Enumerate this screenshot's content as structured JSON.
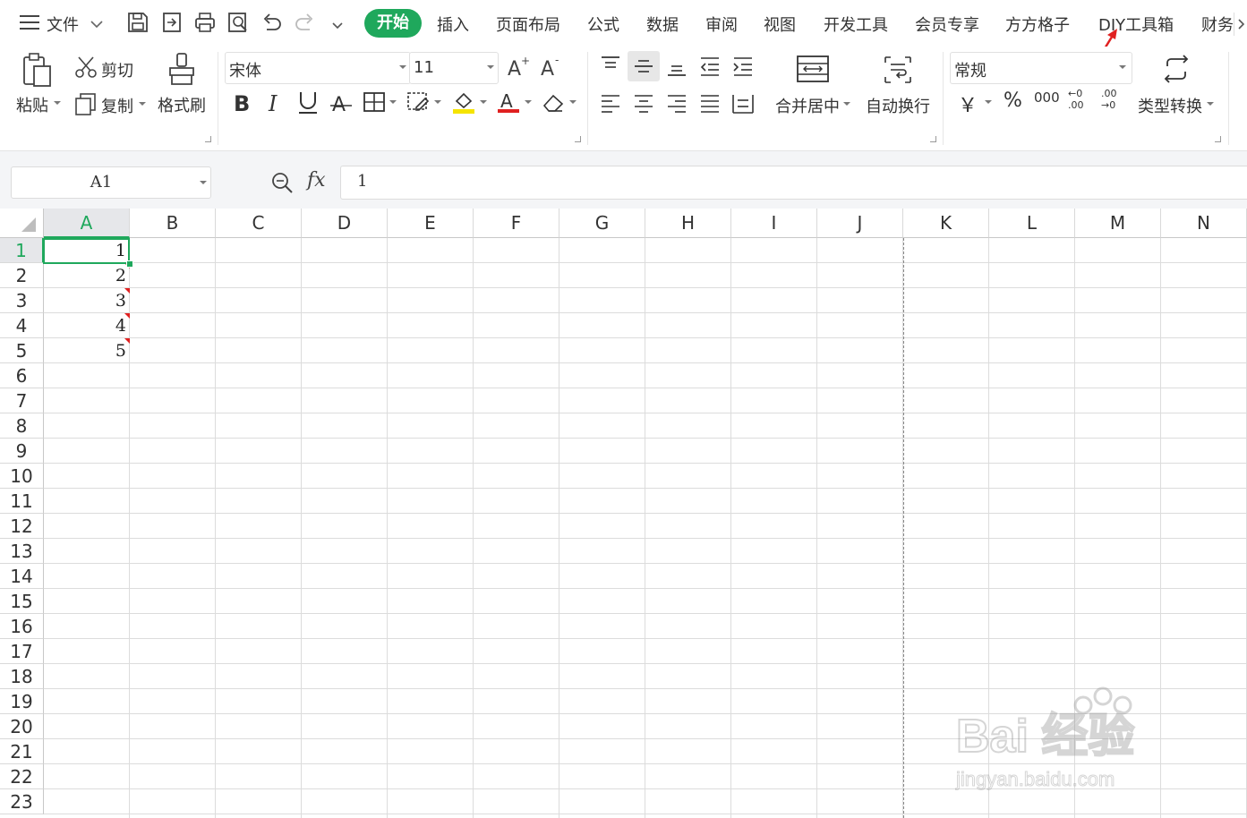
{
  "menubar": {
    "file_label": "文件",
    "tabs": [
      "开始",
      "插入",
      "页面布局",
      "公式",
      "数据",
      "审阅",
      "视图",
      "开发工具",
      "会员专享",
      "方方格子",
      "DIY工具箱",
      "财务"
    ],
    "active_tab": "开始",
    "accent_color": "#1fa85c"
  },
  "ribbon": {
    "paste_label": "粘贴",
    "cut_label": "剪切",
    "copy_label": "复制",
    "format_painter_label": "格式刷",
    "font_name": "宋体",
    "font_size": "11",
    "merge_center_label": "合并居中",
    "wrap_text_label": "自动换行",
    "number_format": "常规",
    "type_convert_label": "类型转换",
    "currency_symbol": "￥",
    "percent_symbol": "%",
    "thousands_symbol": "000",
    "dec_inc_label": "←0 .00",
    "dec_dec_label": ".00 →0"
  },
  "formula_bar": {
    "name_box": "A1",
    "fx_label": "fx",
    "content": "1"
  },
  "sheet": {
    "columns": [
      "A",
      "B",
      "C",
      "D",
      "E",
      "F",
      "G",
      "H",
      "I",
      "J",
      "K",
      "L",
      "M",
      "N"
    ],
    "rows": [
      "1",
      "2",
      "3",
      "4",
      "5",
      "6",
      "7",
      "8",
      "9",
      "10",
      "11",
      "12",
      "13",
      "14",
      "15",
      "16",
      "17",
      "18",
      "19",
      "20",
      "21",
      "22",
      "23"
    ],
    "cells_A": [
      "1",
      "2",
      "3",
      "4",
      "5"
    ],
    "selected_cell": "A1"
  },
  "watermark": {
    "brand": "Bai 经验",
    "url": "jingyan.baidu.com"
  }
}
